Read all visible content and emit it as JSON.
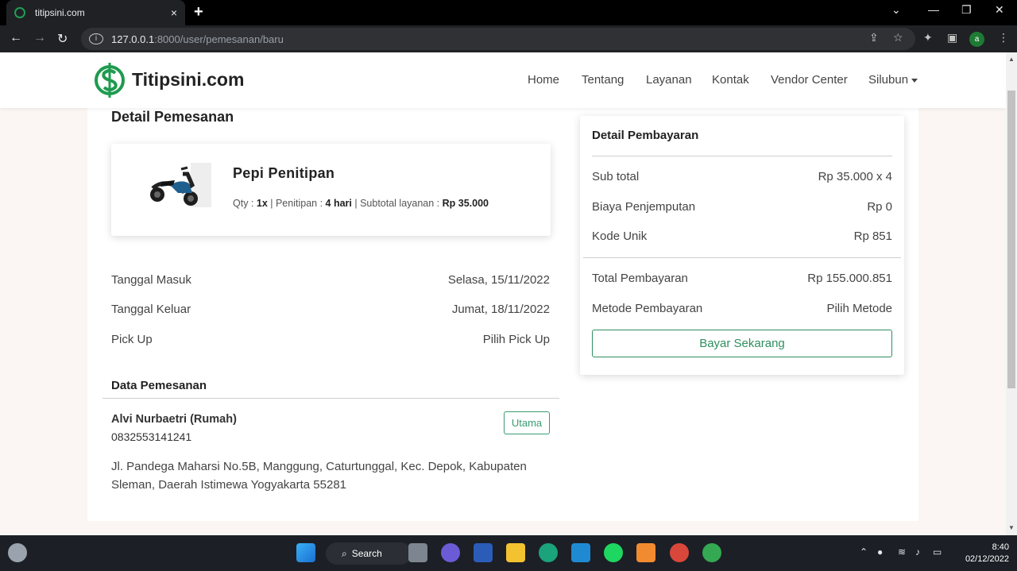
{
  "browser": {
    "tab_title": "titipsini.com",
    "tab_close": "×",
    "new_tab": "+",
    "url_host": "127.0.0.1",
    "url_path": ":8000/user/pemesanan/baru",
    "avatar_letter": "a"
  },
  "header": {
    "brand": "Titipsini.com",
    "nav": [
      "Home",
      "Tentang",
      "Layanan",
      "Kontak",
      "Vendor Center",
      "Silubun"
    ]
  },
  "order": {
    "heading": "Detail Pemesanan",
    "product_name": "Pepi Penitipan",
    "qty_label": "Qty : ",
    "qty_value": "1x",
    "sep1": " | Penitipan : ",
    "duration": "4 hari",
    "sep2": " | Subtotal layanan : ",
    "subtotal": "Rp 35.000",
    "rows": [
      {
        "label": "Tanggal Masuk",
        "value": "Selasa, 15/11/2022"
      },
      {
        "label": "Tanggal Keluar",
        "value": "Jumat, 18/11/2022"
      },
      {
        "label": "Pick Up",
        "value": "Pilih Pick Up"
      }
    ]
  },
  "customer": {
    "heading": "Data Pemesanan",
    "name": "Alvi Nurbaetri (Rumah)",
    "phone": "0832553141241",
    "badge": "Utama",
    "address": "Jl. Pandega Maharsi No.5B, Manggung, Caturtunggal, Kec. Depok, Kabupaten Sleman, Daerah Istimewa Yogyakarta 55281"
  },
  "payment": {
    "title": "Detail Pembayaran",
    "rows": [
      {
        "label": "Sub total",
        "value": "Rp 35.000 x 4"
      },
      {
        "label": "Biaya Penjemputan",
        "value": "Rp 0"
      },
      {
        "label": "Kode Unik",
        "value": "Rp 851"
      }
    ],
    "total_label": "Total Pembayaran",
    "total_value": "Rp 155.000.851",
    "method_label": "Metode Pembayaran",
    "method_value": "Pilih Metode",
    "button": "Bayar Sekarang"
  },
  "taskbar": {
    "search": "Search",
    "time": "8:40",
    "date": "02/12/2022"
  },
  "colors": {
    "accent": "#2f8f5f",
    "page_bg": "#fbf6f3"
  }
}
